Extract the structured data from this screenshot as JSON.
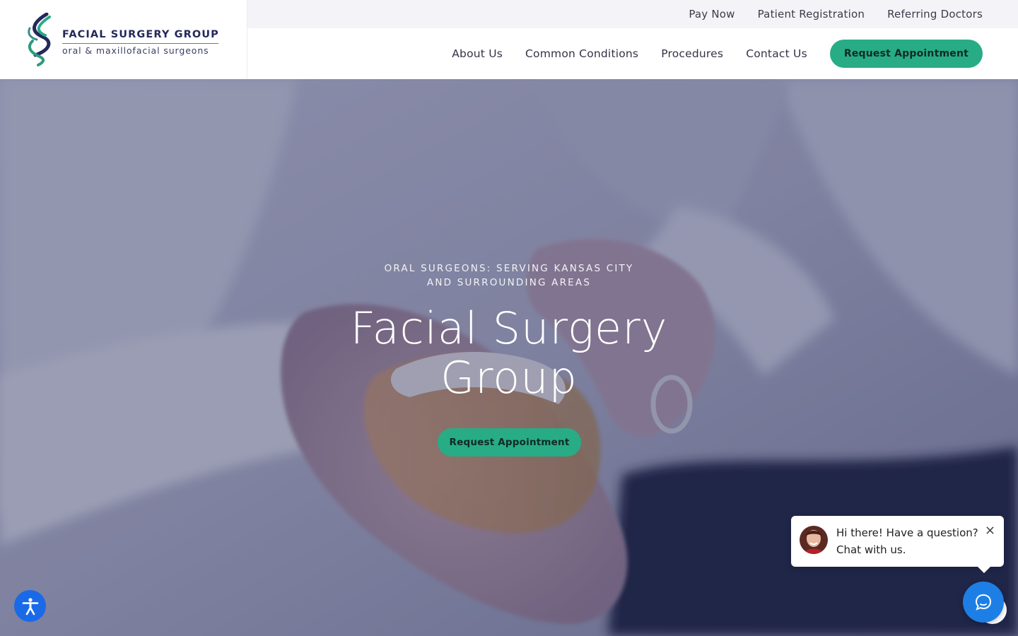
{
  "brand": {
    "title": "FACIAL SURGERY GROUP",
    "subtitle": "oral & maxillofacial surgeons",
    "colors": {
      "navy": "#24285b",
      "green": "#27ac86",
      "teal": "#2a9c7f"
    }
  },
  "topbar": {
    "links": [
      "Pay Now",
      "Patient Registration",
      "Referring Doctors"
    ]
  },
  "nav": {
    "links": [
      "About Us",
      "Common Conditions",
      "Procedures",
      "Contact Us"
    ],
    "cta": "Request Appointment"
  },
  "hero": {
    "eyebrow_line1": "ORAL SURGEONS: SERVING KANSAS CITY",
    "eyebrow_line2": "AND SURROUNDING AREAS",
    "title_line1": "Facial Surgery",
    "title_line2": "Group",
    "cta": "Request Appointment",
    "image_icon": "hands-holding-dental-implant-model"
  },
  "chat": {
    "line1": "Hi there! Have a question?",
    "line2": "Chat with us.",
    "close_icon": "close-icon",
    "launcher_icon": "chat-bubble-icon",
    "accent": "#1d7fe6"
  },
  "accessibility": {
    "icon": "accessibility-icon",
    "color": "#1a6ae8"
  }
}
